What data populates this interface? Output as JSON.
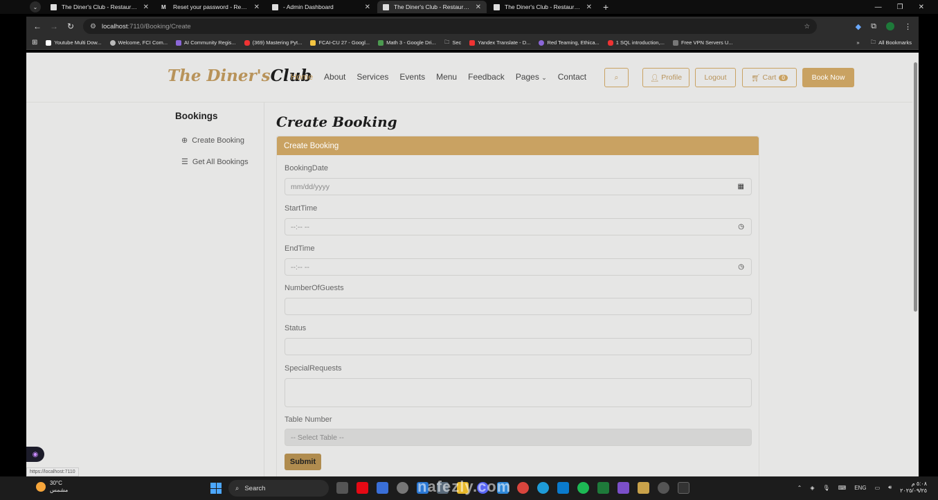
{
  "browser": {
    "tabs": [
      {
        "title": "The Diner's Club - Restaurant &",
        "active": false,
        "icon": "page-icon"
      },
      {
        "title": "Reset your password - Restaura",
        "active": false,
        "icon": "gmail-icon"
      },
      {
        "title": "- Admin Dashboard",
        "active": false,
        "icon": "page-icon"
      },
      {
        "title": "The Diner's Club - Restaurant &",
        "active": true,
        "icon": "page-icon"
      },
      {
        "title": "The Diner's Club - Restaurant &",
        "active": false,
        "icon": "page-icon"
      }
    ],
    "url_host": "localhost",
    "url_path": ":7110/Booking/Create",
    "bookmarks": [
      "Youtube Multi Dow...",
      "Welcome, FCI Com...",
      "AI Community Regis...",
      "(369) Mastering Pyt...",
      "FCAI-CU 27 - Googl...",
      "Math 3 - Google Dri...",
      "Sec",
      "Yandex Translate - D...",
      "Red Teaming, Ethica...",
      "1 SQL introduction,...",
      "Free VPN Servers U..."
    ],
    "all_bookmarks": "All Bookmarks",
    "status_url": "https://localhost:7110"
  },
  "site": {
    "logo_part1": "The Diner's",
    "logo_part2": "Club",
    "nav": [
      "Home",
      "About",
      "Services",
      "Events",
      "Menu",
      "Feedback",
      "Pages",
      "Contact"
    ],
    "profile": "Profile",
    "logout": "Logout",
    "cart": "Cart",
    "cart_count": "0",
    "book_now": "Book Now",
    "accent_color": "#c9a262"
  },
  "sidebar": {
    "title": "Bookings",
    "items": [
      "Create Booking",
      "Get All Bookings"
    ]
  },
  "form": {
    "page_title": "Create Booking",
    "card_title": "Create Booking",
    "labels": {
      "booking_date": "BookingDate",
      "start_time": "StartTime",
      "end_time": "EndTime",
      "guests": "NumberOfGuests",
      "status": "Status",
      "special": "SpecialRequests",
      "table": "Table Number"
    },
    "placeholders": {
      "date": "mm/dd/yyyy",
      "time": "--:-- --",
      "table": "-- Select Table --"
    },
    "submit": "Submit"
  },
  "taskbar": {
    "temp": "30°C",
    "weather": "مشمس",
    "search": "Search",
    "lang": "ENG",
    "time": "٥:٠٨ م",
    "date": "٢٠٢٥/٠٩/٢٥",
    "watermark": "nafezly.com"
  }
}
